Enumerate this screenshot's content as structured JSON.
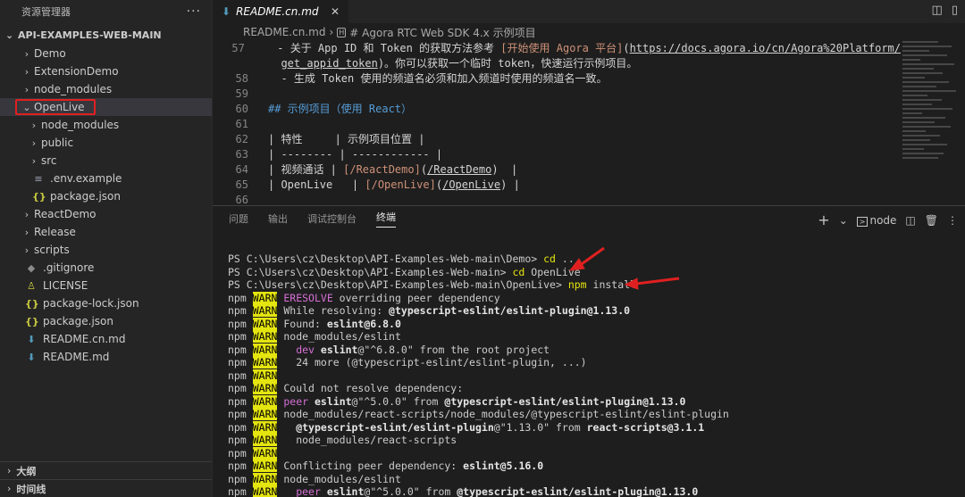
{
  "sidebar": {
    "title": "资源管理器",
    "more": "···",
    "root": "API-EXAMPLES-WEB-MAIN",
    "items": [
      {
        "label": "Demo",
        "type": "folder"
      },
      {
        "label": "ExtensionDemo",
        "type": "folder"
      },
      {
        "label": "node_modules",
        "type": "folder"
      },
      {
        "label": "OpenLive",
        "type": "folder-open"
      },
      {
        "label": "node_modules",
        "type": "folder"
      },
      {
        "label": "public",
        "type": "folder"
      },
      {
        "label": "src",
        "type": "folder"
      },
      {
        "label": ".env.example",
        "type": "file"
      },
      {
        "label": "package.json",
        "type": "json"
      },
      {
        "label": "ReactDemo",
        "type": "folder"
      },
      {
        "label": "Release",
        "type": "folder"
      },
      {
        "label": "scripts",
        "type": "folder"
      },
      {
        "label": ".gitignore",
        "type": "file"
      },
      {
        "label": "LICENSE",
        "type": "file"
      },
      {
        "label": "package-lock.json",
        "type": "json"
      },
      {
        "label": "package.json",
        "type": "json"
      },
      {
        "label": "README.cn.md",
        "type": "md"
      },
      {
        "label": "README.md",
        "type": "md"
      }
    ],
    "bottom": [
      "大纲",
      "时间线"
    ]
  },
  "editor": {
    "tab": "README.cn.md",
    "breadcrumb": {
      "file": "README.cn.md",
      "section": "# Agora RTC Web SDK 4.x 示例项目"
    },
    "lines": [
      {
        "n": "57",
        "a": "  - 关于 App ID 和 Token 的获取方法参考 ",
        "b": "[开始使用 Agora 平台]",
        "c": "(",
        "d": "https://docs.agora.io/cn/Agora%20Platform/",
        "e": ""
      },
      {
        "n": "",
        "a": "  ",
        "b": "",
        "c": "",
        "d": "get_appid_token",
        "e": ")。你可以获取一个临时 token，快速运行示例项目。"
      },
      {
        "n": "58",
        "a": "  - 生成 Token 使用的频道名必须和加入频道时使用的频道名一致。",
        "b": "",
        "c": "",
        "d": "",
        "e": ""
      },
      {
        "n": "59",
        "a": "",
        "b": "",
        "c": "",
        "d": "",
        "e": ""
      },
      {
        "n": "60",
        "a": "## 示例项目（使用 React）",
        "b": "",
        "c": "",
        "d": "",
        "e": ""
      },
      {
        "n": "61",
        "a": "",
        "b": "",
        "c": "",
        "d": "",
        "e": ""
      },
      {
        "n": "62",
        "a": "| 特性     | 示例项目位置 |",
        "b": "",
        "c": "",
        "d": "",
        "e": ""
      },
      {
        "n": "63",
        "a": "| -------- | ------------ |",
        "b": "",
        "c": "",
        "d": "",
        "e": ""
      },
      {
        "n": "64",
        "a": "| 视频通话 | ",
        "b": "[/ReactDemo]",
        "c": "(",
        "d": "/ReactDemo",
        "e": ")  |"
      },
      {
        "n": "65",
        "a": "| OpenLive   | ",
        "b": "[/OpenLive]",
        "c": "(",
        "d": "/OpenLive",
        "e": ") |"
      },
      {
        "n": "66",
        "a": "",
        "b": "",
        "c": "",
        "d": "",
        "e": ""
      }
    ]
  },
  "panel": {
    "tabs": [
      "问题",
      "输出",
      "调试控制台",
      "终端"
    ],
    "active_tab": "终端",
    "shell": "node",
    "add": "+",
    "dropdown": "⌄"
  },
  "terminal": {
    "prompts": [
      {
        "path": "PS C:\\Users\\cz\\Desktop\\API-Examples-Web-main\\Demo> ",
        "cmd": "cd",
        "arg": " .."
      },
      {
        "path": "PS C:\\Users\\cz\\Desktop\\API-Examples-Web-main> ",
        "cmd": "cd",
        "arg": " OpenLive"
      },
      {
        "path": "PS C:\\Users\\cz\\Desktop\\API-Examples-Web-main\\OpenLive> ",
        "cmd": "npm",
        "arg": " install"
      }
    ],
    "npm": "npm",
    "warn": "WARN",
    "warn_lines": [
      [
        {
          "t": " "
        },
        {
          "t": "ERESOLVE",
          "s": "m"
        },
        {
          "t": " overriding peer dependency"
        }
      ],
      [
        {
          "t": " While resolving: "
        },
        {
          "t": "@typescript-eslint/eslint-plugin@1.13.0",
          "s": "b"
        }
      ],
      [
        {
          "t": " Found: "
        },
        {
          "t": "eslint@6.8.0",
          "s": "b"
        }
      ],
      [
        {
          "t": " node_modules/eslint"
        }
      ],
      [
        {
          "t": "   "
        },
        {
          "t": "dev",
          "s": "m"
        },
        {
          "t": " "
        },
        {
          "t": "eslint",
          "s": "b"
        },
        {
          "t": "@\"^6.8.0\" from the root project"
        }
      ],
      [
        {
          "t": "   24 more (@typescript-eslint/eslint-plugin, ...)"
        }
      ],
      [
        {
          "t": ""
        }
      ],
      [
        {
          "t": " Could not resolve dependency:"
        }
      ],
      [
        {
          "t": " "
        },
        {
          "t": "peer",
          "s": "m"
        },
        {
          "t": " "
        },
        {
          "t": "eslint",
          "s": "b"
        },
        {
          "t": "@\"^5.0.0\" from "
        },
        {
          "t": "@typescript-eslint/eslint-plugin@1.13.0",
          "s": "b"
        }
      ],
      [
        {
          "t": " node_modules/react-scripts/node_modules/@typescript-eslint/eslint-plugin"
        }
      ],
      [
        {
          "t": "   "
        },
        {
          "t": "@typescript-eslint/eslint-plugin",
          "s": "b"
        },
        {
          "t": "@\"1.13.0\" from "
        },
        {
          "t": "react-scripts@3.1.1",
          "s": "b"
        }
      ],
      [
        {
          "t": "   node_modules/react-scripts"
        }
      ],
      [
        {
          "t": ""
        }
      ],
      [
        {
          "t": " Conflicting peer dependency: "
        },
        {
          "t": "eslint@5.16.0",
          "s": "b"
        }
      ],
      [
        {
          "t": " node_modules/eslint"
        }
      ],
      [
        {
          "t": "   "
        },
        {
          "t": "peer",
          "s": "m"
        },
        {
          "t": " "
        },
        {
          "t": "eslint",
          "s": "b"
        },
        {
          "t": "@\"^5.0.0\" from "
        },
        {
          "t": "@typescript-eslint/eslint-plugin@1.13.0",
          "s": "b"
        }
      ]
    ]
  },
  "colors": {
    "warn_bg": "#e5e510",
    "highlight": "#e02020",
    "arrow": "#e02020"
  }
}
